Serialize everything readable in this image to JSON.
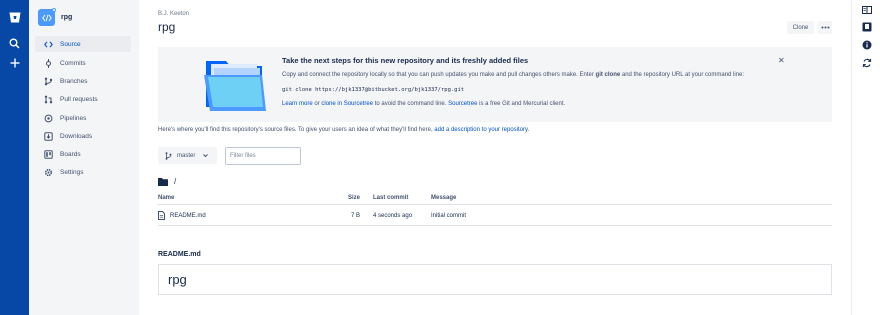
{
  "sidebar": {
    "repo_name": "rpg",
    "items": [
      {
        "label": "Source",
        "icon": "code-icon",
        "active": true
      },
      {
        "label": "Commits",
        "icon": "commit-icon",
        "active": false
      },
      {
        "label": "Branches",
        "icon": "branch-icon",
        "active": false
      },
      {
        "label": "Pull requests",
        "icon": "pull-request-icon",
        "active": false
      },
      {
        "label": "Pipelines",
        "icon": "pipelines-icon",
        "active": false
      },
      {
        "label": "Downloads",
        "icon": "download-icon",
        "active": false
      },
      {
        "label": "Boards",
        "icon": "board-icon",
        "active": false
      },
      {
        "label": "Settings",
        "icon": "gear-icon",
        "active": false
      }
    ]
  },
  "header": {
    "owner": "B.J. Keeton",
    "title": "rpg",
    "clone_label": "Clone"
  },
  "banner": {
    "title": "Take the next steps for this new repository and its freshly added files",
    "text_before": "Copy and connect the repository locally so that you can push updates you make and pull changes others make. Enter ",
    "text_bold": "git clone",
    "text_after": " and the repository URL at your command line:",
    "command": "git clone https://bjk1337@bitbucket.org/bjk1337/rpg.git",
    "learn_more": "Learn more",
    "or": " or ",
    "clone_sourcetree": "clone in Sourcetree",
    "avoid_text": " to avoid the command line. ",
    "sourcetree": "Sourcetree",
    "free_text": " is a free Git and Mercurial client."
  },
  "source": {
    "intro_text": "Here's where you'll find this repository's source files. To give your users an idea of what they'll find here, ",
    "intro_link": "add a description to your repository",
    "intro_end": ".",
    "branch": "master",
    "filter_placeholder": "Filter files",
    "path": "/",
    "columns": {
      "name": "Name",
      "size": "Size",
      "last_commit": "Last commit",
      "message": "Message"
    },
    "files": [
      {
        "name": "README.md",
        "size": "7 B",
        "last_commit": "4 seconds ago",
        "message": "Initial commit"
      }
    ]
  },
  "readme": {
    "label": "README.md",
    "heading": "rpg"
  },
  "colors": {
    "global_nav": "#0747a6",
    "link": "#0052cc",
    "sidebar_bg": "#f4f5f7"
  }
}
